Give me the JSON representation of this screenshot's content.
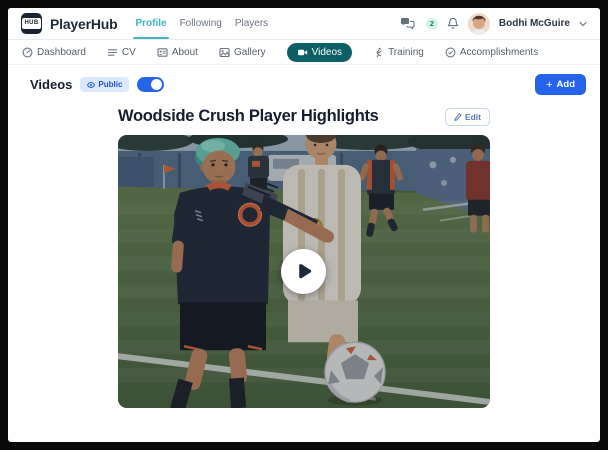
{
  "app": {
    "name": "PlayerHub",
    "logo_text": "HUB"
  },
  "topnav": {
    "links": [
      {
        "label": "Profile",
        "active": true
      },
      {
        "label": "Following",
        "active": false
      },
      {
        "label": "Players",
        "active": false
      }
    ],
    "messages_count": "2",
    "user_name": "Bodhi McGuire"
  },
  "subnav": {
    "items": [
      {
        "label": "Dashboard",
        "active": false
      },
      {
        "label": "CV",
        "active": false
      },
      {
        "label": "About",
        "active": false
      },
      {
        "label": "Gallery",
        "active": false
      },
      {
        "label": "Videos",
        "active": true
      },
      {
        "label": "Training",
        "active": false
      },
      {
        "label": "Accomplishments",
        "active": false
      }
    ]
  },
  "section": {
    "title": "Videos",
    "visibility_badge": "Public",
    "toggle_state": "on",
    "add_label": "Add"
  },
  "video": {
    "title": "Woodside Crush Player Highlights",
    "edit_label": "Edit",
    "description": "soccer match video thumbnail with centered play button"
  },
  "icons": {
    "plus": "+"
  },
  "colors": {
    "accent_blue": "#2563eb",
    "active_tab_teal": "#0d5f66",
    "profile_link_teal": "#41b4c2",
    "badge_bg": "#dbe7fb",
    "badge_text": "#1d53c9",
    "message_badge_bg": "#d5f2e7",
    "message_badge_text": "#13806f"
  }
}
